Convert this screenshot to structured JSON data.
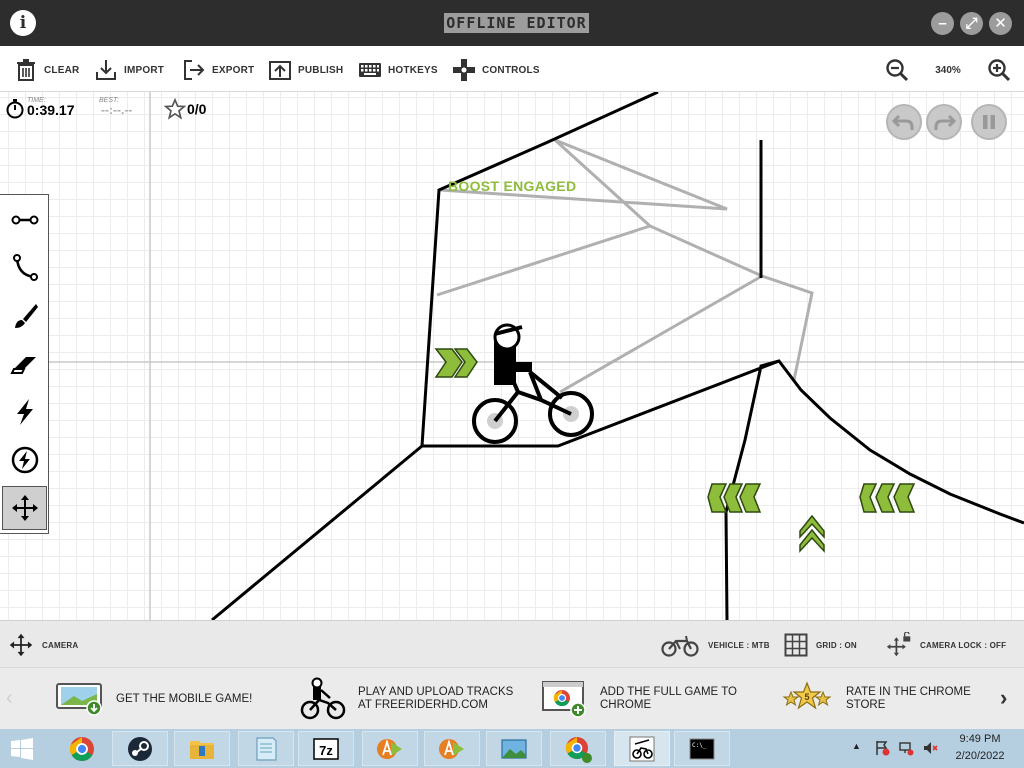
{
  "window": {
    "title": "OFFLINE EDITOR",
    "info_icon": "info-icon",
    "controls": [
      "minimize-icon",
      "fullscreen-icon",
      "close-icon"
    ]
  },
  "toolbar": {
    "clear": "CLEAR",
    "import": "IMPORT",
    "export": "EXPORT",
    "publish": "PUBLISH",
    "hotkeys": "HOTKEYS",
    "controls": "CONTROLS",
    "zoom_level": "340%"
  },
  "hud": {
    "time_label": "TIME:",
    "time": "0:39.17",
    "best_label": "BEST:",
    "best": "--:--.--",
    "stars": "0/0"
  },
  "canvas": {
    "boost_text": "BOOST ENGAGED",
    "accent_green": "#8dbd3a",
    "line_color": "#000000",
    "scenery_color": "#b0b0b0"
  },
  "tools": [
    "line-tool-icon",
    "curve-tool-icon",
    "brush-tool-icon",
    "eraser-tool-icon",
    "powerup-tool-icon",
    "powerup-alt-icon",
    "camera-move-icon"
  ],
  "statusbar": {
    "camera": "CAMERA",
    "vehicle": "VEHICLE : MTB",
    "grid": "GRID : ON",
    "camera_lock": "CAMERA LOCK : OFF"
  },
  "promos": [
    {
      "text": "GET THE MOBILE GAME!"
    },
    {
      "line1": "PLAY AND UPLOAD TRACKS",
      "line2": "AT FREERIDERHD.COM"
    },
    {
      "line1": "ADD THE FULL GAME TO",
      "line2": "CHROME"
    },
    {
      "line1": "RATE IN THE CHROME",
      "line2": "STORE"
    }
  ],
  "taskbar": {
    "apps": [
      "windows-start-icon",
      "chrome-icon",
      "steam-icon",
      "file-explorer-icon",
      "notepad-icon",
      "7zip-icon",
      "app-icon-1",
      "app-icon-2",
      "photos-icon",
      "chrome-profile-icon",
      "freerider-icon",
      "cmd-icon"
    ],
    "time": "9:49 PM",
    "date": "2/20/2022"
  }
}
